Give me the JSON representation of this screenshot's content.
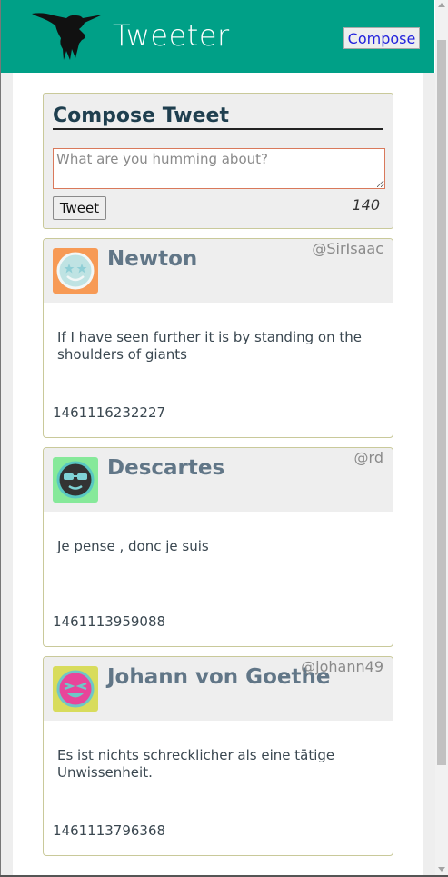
{
  "header": {
    "brand": "Tweeter",
    "compose_button": "Compose",
    "background_color": "#00a087"
  },
  "compose": {
    "title": "Compose Tweet",
    "placeholder": "What are you humming about?",
    "value": "",
    "tweet_button": "Tweet",
    "char_counter": "140"
  },
  "tweets": [
    {
      "name": "Newton",
      "handle": "@SirIsaac",
      "text": "If I have seen further it is by standing on the shoulders of giants",
      "created_at": "1461116232227",
      "avatar_bg": "#f79a55",
      "avatar_icon": "star-eyes-face-icon"
    },
    {
      "name": "Descartes",
      "handle": "@rd",
      "text": "Je pense , donc je suis",
      "created_at": "1461113959088",
      "avatar_bg": "#86e99a",
      "avatar_icon": "sunglasses-face-icon"
    },
    {
      "name": "Johann von Goethe",
      "handle": "@johann49",
      "text": "Es ist nichts schrecklicher als eine tätige Unwissenheit.",
      "created_at": "1461113796368",
      "avatar_bg": "#d8dc5c",
      "avatar_icon": "laughing-face-icon"
    }
  ]
}
